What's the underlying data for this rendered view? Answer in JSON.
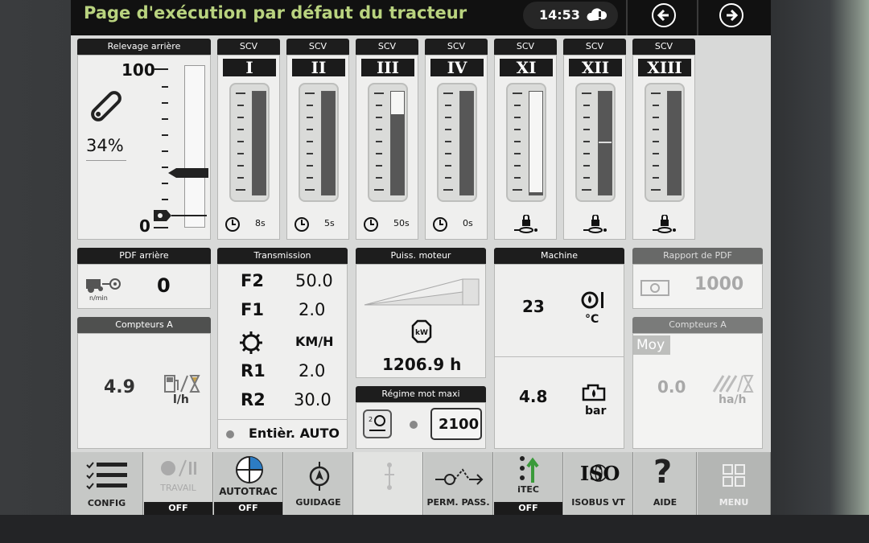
{
  "header": {
    "title": "Page d'exécution par défaut du tracteur",
    "time": "14:53"
  },
  "relevage": {
    "tab": "Relevage arrière",
    "max": "100",
    "min": "0",
    "percent": "34%"
  },
  "scv": {
    "tab": "SCV",
    "items": [
      {
        "roman": "I",
        "foot": "8s",
        "level": 1.0
      },
      {
        "roman": "II",
        "foot": "5s",
        "level": 1.0
      },
      {
        "roman": "III",
        "foot": "50s",
        "level": 0.78
      },
      {
        "roman": "IV",
        "foot": "0s",
        "level": 1.0
      },
      {
        "roman": "XI",
        "foot": "",
        "level": 0.0
      },
      {
        "roman": "XII",
        "foot": "",
        "level": 1.0
      },
      {
        "roman": "XIII",
        "foot": "",
        "level": 1.0
      }
    ]
  },
  "pdf_arriere": {
    "tab": "PDF arrière",
    "value": "0",
    "unit": "n/min"
  },
  "compteurs_a": {
    "tab": "Compteurs A",
    "value": "4.9",
    "unit": "l/h"
  },
  "transmission": {
    "tab": "Transmission",
    "rows": [
      {
        "label": "F2",
        "value": "50.0"
      },
      {
        "label": "F1",
        "value": "2.0"
      },
      {
        "label": "",
        "value": "KM/H"
      },
      {
        "label": "R1",
        "value": "2.0"
      },
      {
        "label": "R2",
        "value": "30.0"
      }
    ],
    "mode": "Entièr. AUTO"
  },
  "puissance": {
    "tab": "Puiss. moteur",
    "icon_text": "kW",
    "hours": "1206.9 h"
  },
  "regime": {
    "tab": "Régime mot maxi",
    "value": "2100"
  },
  "machine": {
    "tab": "Machine",
    "temp": "23",
    "temp_unit": "°C",
    "pressure": "4.8",
    "pressure_unit": "bar"
  },
  "rapport_pdf": {
    "tab": "Rapport de PDF",
    "value": "1000"
  },
  "compteurs_a2": {
    "tab": "Compteurs A",
    "moy": "Moy",
    "value": "0.0",
    "unit": "ha/h"
  },
  "bottom_bar": {
    "config": "CONFIG",
    "travail": "TRAVAIL",
    "travail_state": "OFF",
    "autotrac": "AUTOTRAC",
    "autotrac_state": "OFF",
    "guidage": "GUIDAGE",
    "perm_pass": "PERM. PASS.",
    "itec": "iTEC",
    "itec_state": "OFF",
    "iso_logo": "ISO",
    "isobus": "ISOBUS VT",
    "aide": "AIDE",
    "menu": "MENU"
  },
  "colors": {
    "title_green": "#b9d37f",
    "panel_bg": "#efefee",
    "tab_black": "#1d1d1d",
    "fill_grey": "#575757"
  }
}
